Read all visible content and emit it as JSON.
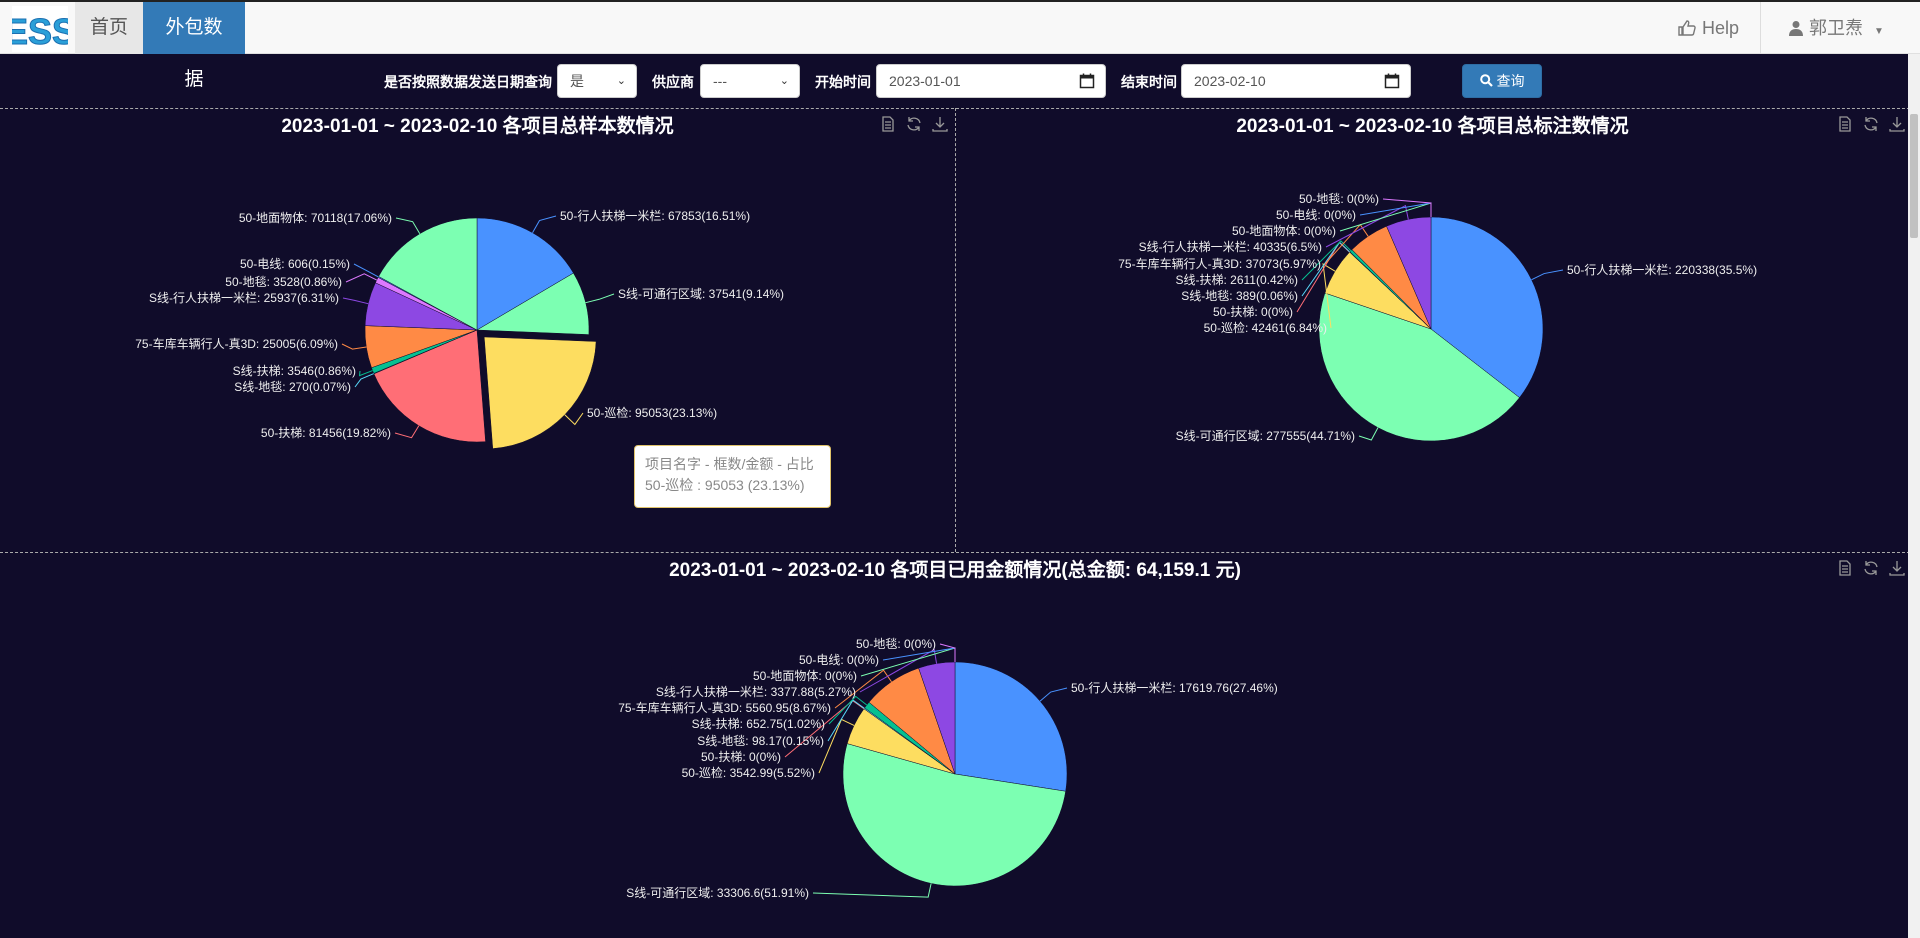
{
  "nav": {
    "logo": "ESS",
    "home": "首页",
    "active_tab": "外包数据",
    "help": "Help",
    "user": "郭卫焘"
  },
  "toolbar": {
    "by_send_date_label": "是否按照数据发送日期查询",
    "by_send_date_value": "是",
    "vendor_label": "供应商",
    "vendor_value": "---",
    "start_label": "开始时间",
    "start_value": "2023-01-01",
    "end_label": "结束时间",
    "end_value": "2023-02-10",
    "query_label": "查询"
  },
  "tooltip": {
    "header": "项目名字 - 框数/金额 - 占比",
    "body": "50-巡检 : 95053 (23.13%)"
  },
  "colors": {
    "background": "#100c2a",
    "blue": "#4992ff",
    "green": "#7cffb2",
    "yellow": "#fddd60",
    "red": "#ff6e76",
    "teal": "#58d9f9",
    "darkgreen": "#05c091",
    "orange": "#ff8a45",
    "purple": "#8d48e3",
    "pink": "#dd79ff",
    "primary": "#337ab7"
  },
  "chart_data": [
    {
      "type": "pie",
      "title": "2023-01-01 ~ 2023-02-10 各项目总样本数情况",
      "series": [
        {
          "name": "50-行人扶梯一米栏",
          "value": 67853,
          "label": "50-行人扶梯一米栏: 67853(16.51%)",
          "color": "#4992ff"
        },
        {
          "name": "S线-可通行区域",
          "value": 37541,
          "label": "S线-可通行区域: 37541(9.14%)",
          "color": "#7cffb2"
        },
        {
          "name": "50-巡检",
          "value": 95053,
          "label": "50-巡检: 95053(23.13%)",
          "color": "#fddd60",
          "highlighted": true
        },
        {
          "name": "50-扶梯",
          "value": 81456,
          "label": "50-扶梯: 81456(19.82%)",
          "color": "#ff6e76"
        },
        {
          "name": "S线-地毯",
          "value": 270,
          "label": "S线-地毯: 270(0.07%)",
          "color": "#58d9f9"
        },
        {
          "name": "S线-扶梯",
          "value": 3546,
          "label": "S线-扶梯: 3546(0.86%)",
          "color": "#05c091"
        },
        {
          "name": "75-车库车辆行人-真3D",
          "value": 25005,
          "label": "75-车库车辆行人-真3D: 25005(6.09%)",
          "color": "#ff8a45"
        },
        {
          "name": "S线-行人扶梯一米栏",
          "value": 25937,
          "label": "S线-行人扶梯一米栏: 25937(6.31%)",
          "color": "#8d48e3"
        },
        {
          "name": "50-地毯",
          "value": 3528,
          "label": "50-地毯: 3528(0.86%)",
          "color": "#dd79ff"
        },
        {
          "name": "50-电线",
          "value": 606,
          "label": "50-电线: 606(0.15%)",
          "color": "#4992ff"
        },
        {
          "name": "50-地面物体",
          "value": 70118,
          "label": "50-地面物体: 70118(17.06%)",
          "color": "#7cffb2"
        }
      ]
    },
    {
      "type": "pie",
      "title": "2023-01-01 ~ 2023-02-10 各项目总标注数情况",
      "series": [
        {
          "name": "50-行人扶梯一米栏",
          "value": 220338,
          "label": "50-行人扶梯一米栏: 220338(35.5%)",
          "color": "#4992ff"
        },
        {
          "name": "S线-可通行区域",
          "value": 277555,
          "label": "S线-可通行区域: 277555(44.71%)",
          "color": "#7cffb2"
        },
        {
          "name": "50-巡检",
          "value": 42461,
          "label": "50-巡检: 42461(6.84%)",
          "color": "#fddd60"
        },
        {
          "name": "50-扶梯",
          "value": 0,
          "label": "50-扶梯: 0(0%)",
          "color": "#ff6e76"
        },
        {
          "name": "S线-地毯",
          "value": 389,
          "label": "S线-地毯: 389(0.06%)",
          "color": "#58d9f9"
        },
        {
          "name": "S线-扶梯",
          "value": 2611,
          "label": "S线-扶梯: 2611(0.42%)",
          "color": "#05c091"
        },
        {
          "name": "75-车库车辆行人-真3D",
          "value": 37073,
          "label": "75-车库车辆行人-真3D: 37073(5.97%)",
          "color": "#ff8a45"
        },
        {
          "name": "S线-行人扶梯一米栏",
          "value": 40335,
          "label": "S线-行人扶梯一米栏: 40335(6.5%)",
          "color": "#8d48e3"
        },
        {
          "name": "50-地面物体",
          "value": 0,
          "label": "50-地面物体: 0(0%)",
          "color": "#7cffb2"
        },
        {
          "name": "50-电线",
          "value": 0,
          "label": "50-电线: 0(0%)",
          "color": "#4992ff"
        },
        {
          "name": "50-地毯",
          "value": 0,
          "label": "50-地毯: 0(0%)",
          "color": "#dd79ff"
        }
      ]
    },
    {
      "type": "pie",
      "title": "2023-01-01 ~ 2023-02-10 各项目已用金额情况(总金额: 64,159.1 元)",
      "series": [
        {
          "name": "50-行人扶梯一米栏",
          "value": 17619.76,
          "label": "50-行人扶梯一米栏: 17619.76(27.46%)",
          "color": "#4992ff"
        },
        {
          "name": "S线-可通行区域",
          "value": 33306.6,
          "label": "S线-可通行区域: 33306.6(51.91%)",
          "color": "#7cffb2"
        },
        {
          "name": "50-巡检",
          "value": 3542.99,
          "label": "50-巡检: 3542.99(5.52%)",
          "color": "#fddd60"
        },
        {
          "name": "50-扶梯",
          "value": 0,
          "label": "50-扶梯: 0(0%)",
          "color": "#ff6e76"
        },
        {
          "name": "S线-地毯",
          "value": 98.17,
          "label": "S线-地毯: 98.17(0.15%)",
          "color": "#58d9f9"
        },
        {
          "name": "S线-扶梯",
          "value": 652.75,
          "label": "S线-扶梯: 652.75(1.02%)",
          "color": "#05c091"
        },
        {
          "name": "75-车库车辆行人-真3D",
          "value": 5560.95,
          "label": "75-车库车辆行人-真3D: 5560.95(8.67%)",
          "color": "#ff8a45"
        },
        {
          "name": "S线-行人扶梯一米栏",
          "value": 3377.88,
          "label": "S线-行人扶梯一米栏: 3377.88(5.27%)",
          "color": "#8d48e3"
        },
        {
          "name": "50-地面物体",
          "value": 0,
          "label": "50-地面物体: 0(0%)",
          "color": "#7cffb2"
        },
        {
          "name": "50-电线",
          "value": 0,
          "label": "50-电线: 0(0%)",
          "color": "#4992ff"
        },
        {
          "name": "50-地毯",
          "value": 0,
          "label": "50-地毯: 0(0%)",
          "color": "#dd79ff"
        }
      ]
    }
  ]
}
